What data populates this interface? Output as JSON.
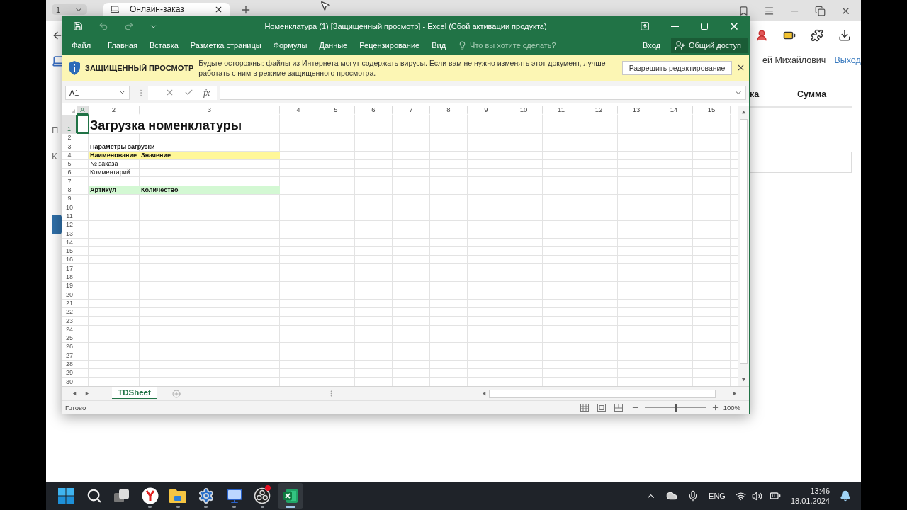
{
  "browser": {
    "tab_counter": "1",
    "tabs": [
      {
        "title": "Онлайн-заказ",
        "selected": true
      }
    ],
    "page": {
      "left_fragments": [
        "П",
        "К"
      ],
      "user_name": "ей Михайлович",
      "logout_link": "Выход",
      "columns": [
        "ка",
        "Сумма"
      ]
    }
  },
  "excel": {
    "title": "Номенклатура (1)  [Защищенный просмотр] - Excel (Сбой активации продукта)",
    "ribbon_tabs": [
      "Файл",
      "Главная",
      "Вставка",
      "Разметка страницы",
      "Формулы",
      "Данные",
      "Рецензирование",
      "Вид"
    ],
    "tell_me": {
      "placeholder": "Что вы хотите сделать?"
    },
    "sign_in": "Вход",
    "share": "Общий доступ",
    "message_bar": {
      "title": "ЗАЩИЩЕННЫЙ ПРОСМОТР",
      "text": "Будьте осторожны: файлы из Интернета могут содержать вирусы. Если вам не нужно изменять этот документ, лучше работать с ним в режиме защищенного просмотра.",
      "button": "Разрешить редактирование"
    },
    "name_box": "A1",
    "function_label": "fx",
    "columns": [
      {
        "label": "A",
        "selected": true
      },
      {
        "label": "2",
        "selected": false
      },
      {
        "label": "3",
        "selected": false
      },
      {
        "label": "4",
        "selected": false
      },
      {
        "label": "5",
        "selected": false
      },
      {
        "label": "6",
        "selected": false
      },
      {
        "label": "7",
        "selected": false
      },
      {
        "label": "8",
        "selected": false
      },
      {
        "label": "9",
        "selected": false
      },
      {
        "label": "10",
        "selected": false
      },
      {
        "label": "11",
        "selected": false
      },
      {
        "label": "12",
        "selected": false
      },
      {
        "label": "13",
        "selected": false
      },
      {
        "label": "14",
        "selected": false
      },
      {
        "label": "15",
        "selected": false
      }
    ],
    "rows": [
      {
        "number": "1",
        "selected": true,
        "kind": "title",
        "col_2": "Загрузка номенклатуры"
      },
      {
        "number": "2",
        "selected": false,
        "kind": "empty"
      },
      {
        "number": "3",
        "selected": false,
        "kind": "bold",
        "col_2": "Параметры загрузки"
      },
      {
        "number": "4",
        "selected": false,
        "kind": "bold",
        "color": "#fff799",
        "col_2": "Наименование",
        "col_3": "Значение"
      },
      {
        "number": "5",
        "selected": false,
        "kind": "plain",
        "col_2": "№ заказа"
      },
      {
        "number": "6",
        "selected": false,
        "kind": "plain",
        "col_2": "Комментарий"
      },
      {
        "number": "7",
        "selected": false,
        "kind": "empty"
      },
      {
        "number": "8",
        "selected": false,
        "kind": "bold",
        "color": "#d3f8d3",
        "col_2": "Артикул",
        "col_3": "Количество"
      },
      {
        "number": "9",
        "selected": false,
        "kind": "empty"
      },
      {
        "number": "10",
        "selected": false,
        "kind": "empty"
      },
      {
        "number": "11",
        "selected": false,
        "kind": "empty"
      },
      {
        "number": "12",
        "selected": false,
        "kind": "empty"
      },
      {
        "number": "13",
        "selected": false,
        "kind": "empty"
      },
      {
        "number": "14",
        "selected": false,
        "kind": "empty"
      },
      {
        "number": "15",
        "selected": false,
        "kind": "empty"
      },
      {
        "number": "16",
        "selected": false,
        "kind": "empty"
      },
      {
        "number": "17",
        "selected": false,
        "kind": "empty"
      },
      {
        "number": "18",
        "selected": false,
        "kind": "empty"
      },
      {
        "number": "19",
        "selected": false,
        "kind": "empty"
      },
      {
        "number": "20",
        "selected": false,
        "kind": "empty"
      },
      {
        "number": "21",
        "selected": false,
        "kind": "empty"
      },
      {
        "number": "22",
        "selected": false,
        "kind": "empty"
      },
      {
        "number": "23",
        "selected": false,
        "kind": "empty"
      },
      {
        "number": "24",
        "selected": false,
        "kind": "empty"
      },
      {
        "number": "25",
        "selected": false,
        "kind": "empty"
      },
      {
        "number": "26",
        "selected": false,
        "kind": "empty"
      },
      {
        "number": "27",
        "selected": false,
        "kind": "empty"
      },
      {
        "number": "28",
        "selected": false,
        "kind": "empty"
      },
      {
        "number": "29",
        "selected": false,
        "kind": "empty"
      },
      {
        "number": "30",
        "selected": false,
        "kind": "empty"
      }
    ],
    "sheets": [
      {
        "name": "TDSheet",
        "selected": true
      }
    ],
    "status": "Готово",
    "zoom": {
      "level": 0.5,
      "reading": "100%"
    }
  },
  "taskbar": {
    "apps": [
      {
        "kind": "start",
        "running": false,
        "active": false
      },
      {
        "kind": "search",
        "running": false,
        "active": false
      },
      {
        "kind": "task-view",
        "running": false,
        "active": false
      },
      {
        "kind": "browser",
        "running": true,
        "active": false
      },
      {
        "kind": "folder",
        "running": true,
        "active": false
      },
      {
        "kind": "settings",
        "running": true,
        "active": false
      },
      {
        "kind": "remote",
        "running": true,
        "active": false
      },
      {
        "kind": "recorder",
        "running": true,
        "active": false,
        "badge": true
      },
      {
        "kind": "spreadsheet",
        "running": true,
        "active": true
      }
    ],
    "tray": {
      "language": "ENG",
      "time": "13:46",
      "date": "18.01.2024"
    }
  }
}
